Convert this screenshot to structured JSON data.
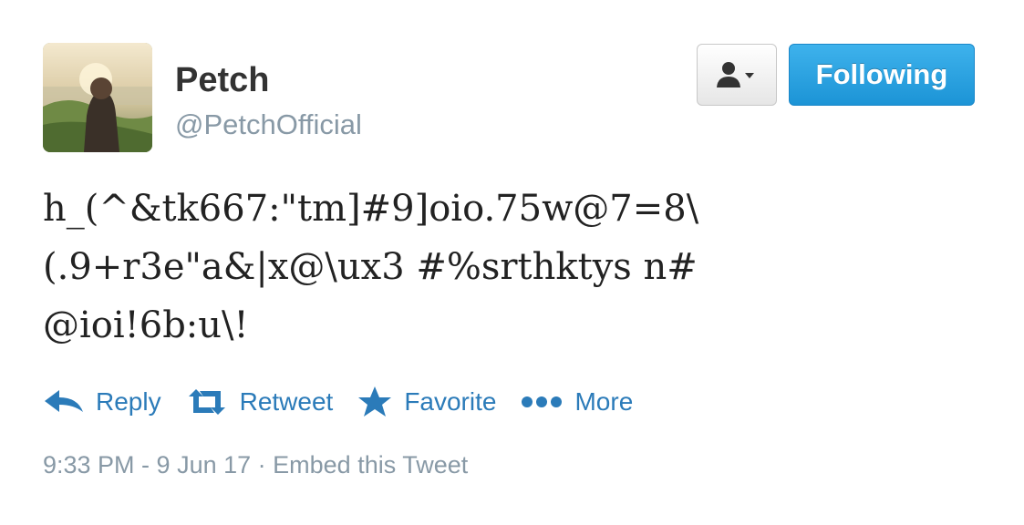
{
  "user": {
    "display_name": "Petch",
    "screen_name": "@PetchOfficial",
    "avatar_icon": "profile-photo"
  },
  "header": {
    "user_menu_icon": "person-dropdown-icon",
    "follow_label": "Following"
  },
  "tweet": {
    "lines": [
      "h_(^&tk667:\"tm]#9]oio.75w@7=8\\",
      "(.9+r3e\"a&|x@\\ux3 #%srthktys n#",
      "@ioi!6b:u\\!"
    ]
  },
  "actions": {
    "reply_label": "Reply",
    "retweet_label": "Retweet",
    "favorite_label": "Favorite",
    "more_label": "More"
  },
  "meta": {
    "timestamp": "9:33 PM - 9 Jun 17",
    "separator": " · ",
    "embed_label": "Embed this Tweet"
  },
  "colors": {
    "accent": "#2b7bb9",
    "follow_button": "#1c94d6",
    "muted": "#8899a6"
  }
}
